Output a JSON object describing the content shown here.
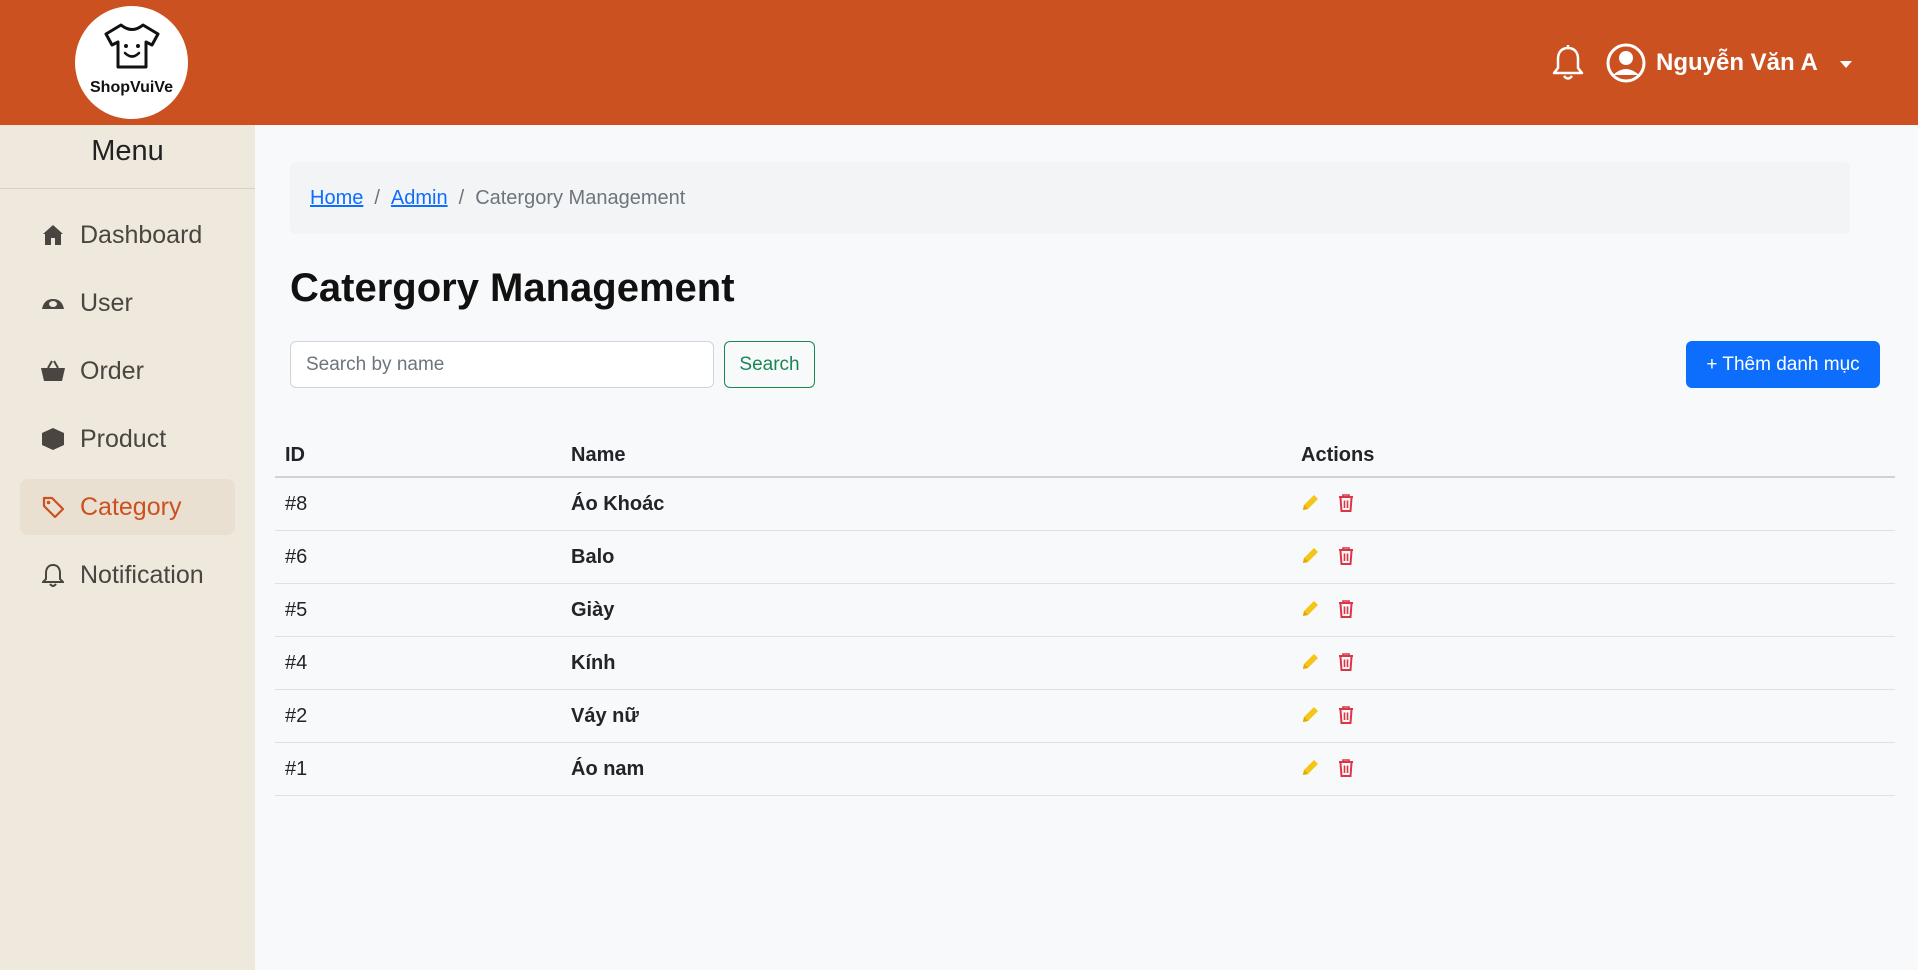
{
  "brand": {
    "name": "ShopVuiVe"
  },
  "header": {
    "user_name": "Nguyễn Văn A"
  },
  "sidebar": {
    "title": "Menu",
    "items": [
      {
        "label": "Dashboard",
        "icon": "home-icon",
        "active": false
      },
      {
        "label": "User",
        "icon": "user-icon",
        "active": false
      },
      {
        "label": "Order",
        "icon": "basket-icon",
        "active": false
      },
      {
        "label": "Product",
        "icon": "box-icon",
        "active": false
      },
      {
        "label": "Category",
        "icon": "tag-icon",
        "active": true
      },
      {
        "label": "Notification",
        "icon": "bell-icon",
        "active": false
      }
    ]
  },
  "breadcrumb": {
    "home": "Home",
    "admin": "Admin",
    "current": "Catergory Management"
  },
  "page": {
    "title": "Catergory Management"
  },
  "search": {
    "placeholder": "Search by name",
    "value": "",
    "button_label": "Search"
  },
  "add_button_label": "+ Thêm danh mục",
  "table": {
    "headers": {
      "id": "ID",
      "name": "Name",
      "actions": "Actions"
    },
    "rows": [
      {
        "id": "#8",
        "name": "Áo Khoác"
      },
      {
        "id": "#6",
        "name": "Balo"
      },
      {
        "id": "#5",
        "name": "Giày"
      },
      {
        "id": "#4",
        "name": "Kính"
      },
      {
        "id": "#2",
        "name": "Váy nữ"
      },
      {
        "id": "#1",
        "name": "Áo nam"
      }
    ]
  },
  "colors": {
    "header": "#cb5120",
    "sidebar": "#efe8dc",
    "active": "#cb5120",
    "primary": "#0d6efd",
    "success": "#198754",
    "edit": "#f5c518",
    "delete": "#dc3545"
  }
}
